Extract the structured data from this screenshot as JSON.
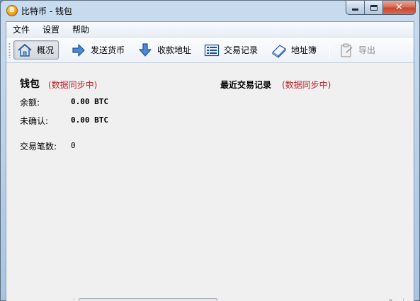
{
  "window": {
    "title": "比特币 - 钱包",
    "app_icon_glyph": "B",
    "controls": {
      "minimize": "minimize-icon",
      "maximize": "maximize-icon",
      "close": "✕"
    }
  },
  "menu": [
    "文件",
    "设置",
    "帮助"
  ],
  "toolbar": {
    "overview": "概况",
    "send": "发送货币",
    "receive": "收款地址",
    "transactions": "交易记录",
    "address_book": "地址簿",
    "export": "导出",
    "active": "overview"
  },
  "overview": {
    "wallet_heading": "钱包",
    "wallet_sync": "(数据同步中)",
    "balance_label": "余额:",
    "balance_value": "0.00 BTC",
    "unconfirmed_label": "未确认:",
    "unconfirmed_value": "0.00 BTC",
    "tx_count_label": "交易笔数:",
    "tx_count_value": "0",
    "recent_heading": "最近交易记录",
    "recent_sync": "(数据同步中)"
  },
  "colors": {
    "sync_text": "#c0202a",
    "window_frame": "#bcd3ea",
    "client_bg": "#f0f0f0",
    "close_button": "#c8462d"
  }
}
